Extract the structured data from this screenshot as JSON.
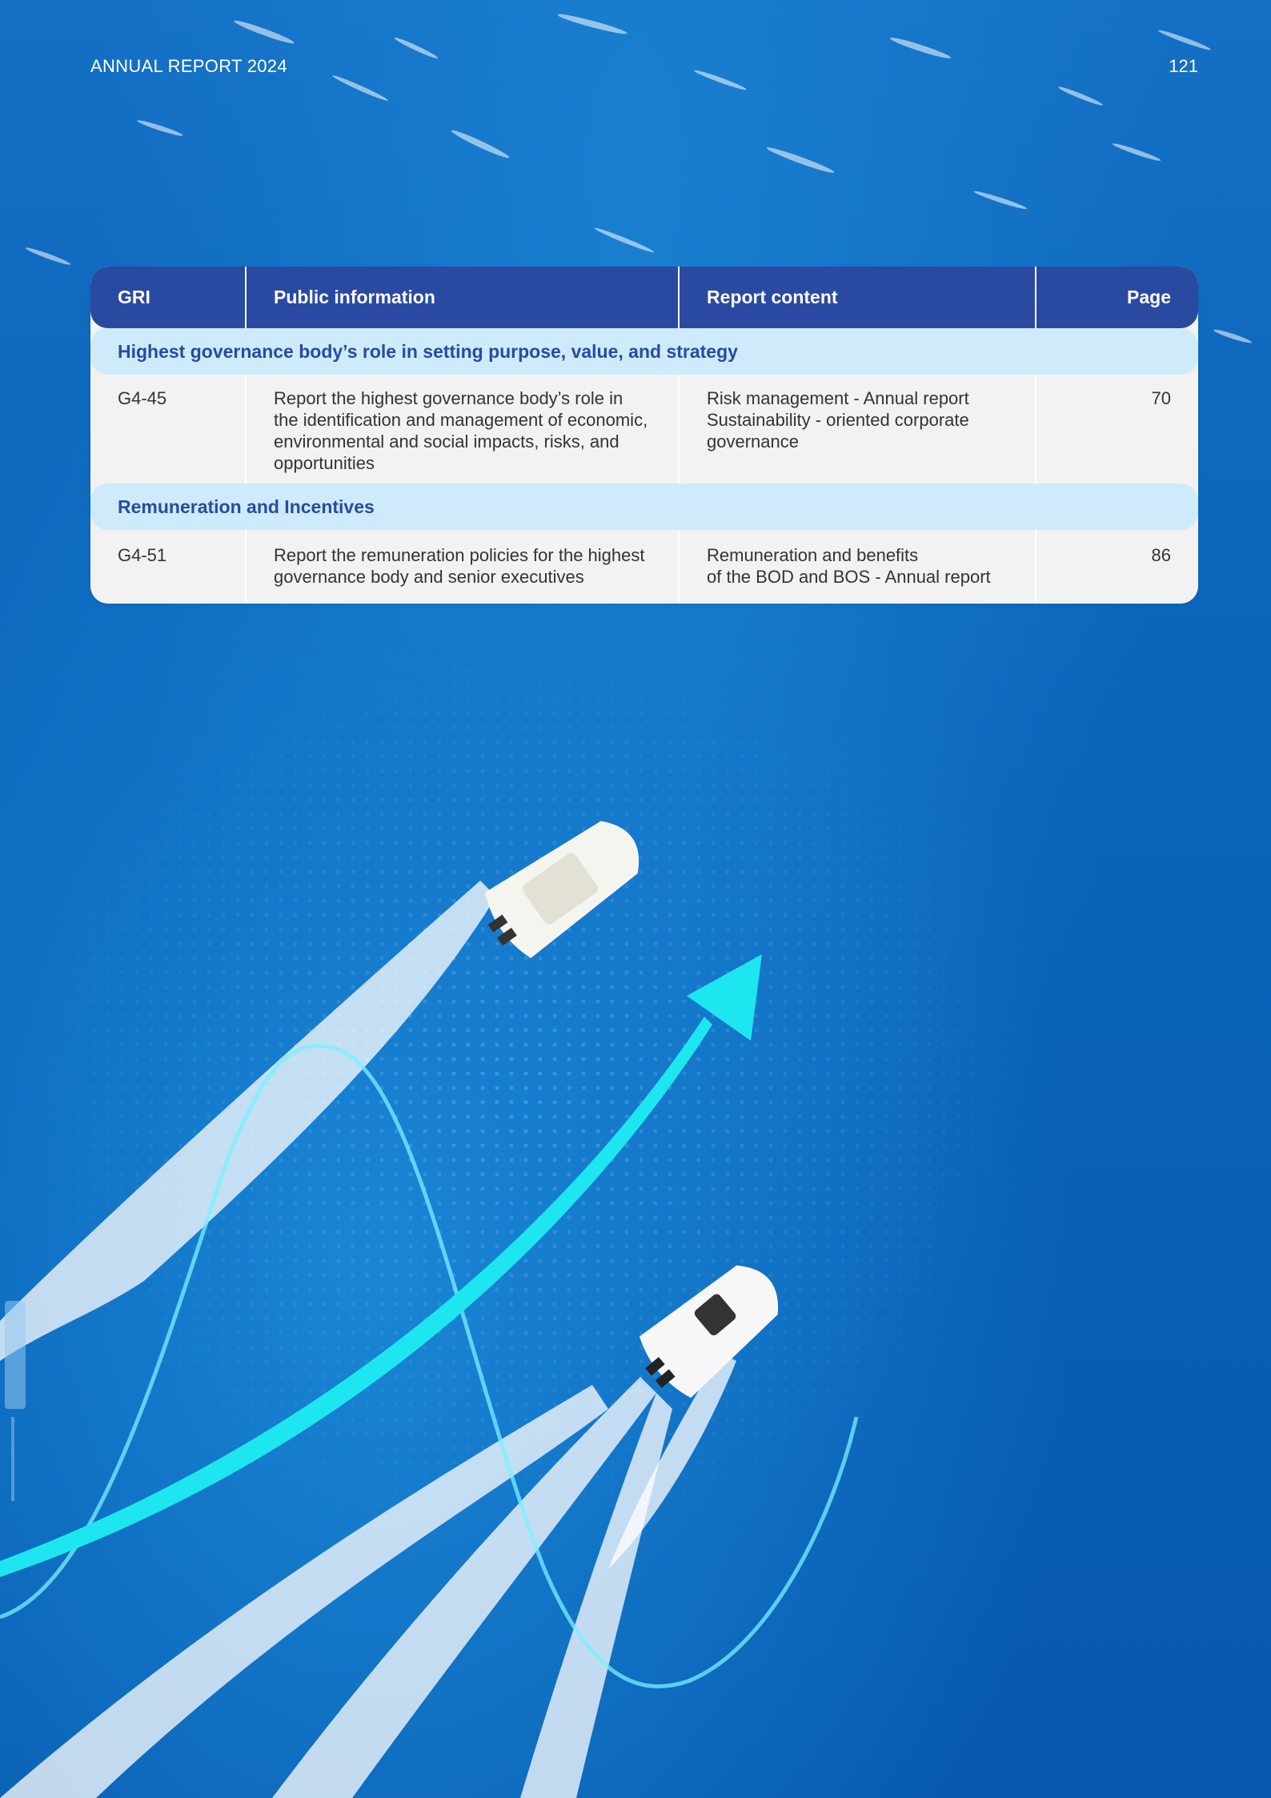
{
  "header": {
    "report_title": "ANNUAL REPORT 2024",
    "page_number": "121"
  },
  "table": {
    "columns": [
      "GRI",
      "Public information",
      "Report content",
      "Page"
    ],
    "sections": [
      {
        "title": "Highest governance body’s role in setting purpose, value, and strategy",
        "rows": [
          {
            "gri": "G4-45",
            "public_information": "Report the highest governance body’s role in the identification and management of economic, environmental and social impacts, risks, and opportunities",
            "report_content_line1": "Risk management - Annual report",
            "report_content_line2": "Sustainability - oriented corporate governance",
            "page": "70"
          }
        ]
      },
      {
        "title": "Remuneration and Incentives",
        "rows": [
          {
            "gri": "G4-51",
            "public_information": "Report the remuneration policies for the highest governance body and senior executives",
            "report_content_line1": "Remuneration and benefits",
            "report_content_line2": "of the BOD and BOS - Annual report",
            "page": "86"
          }
        ]
      }
    ]
  },
  "colors": {
    "header_bg": "#2a4aa1",
    "section_bg": "#cfeafa",
    "section_text": "#2a4aa1",
    "table_bg": "#f2f2f2",
    "ocean": "#0a63b8",
    "arrow": "#1ee6f0"
  }
}
